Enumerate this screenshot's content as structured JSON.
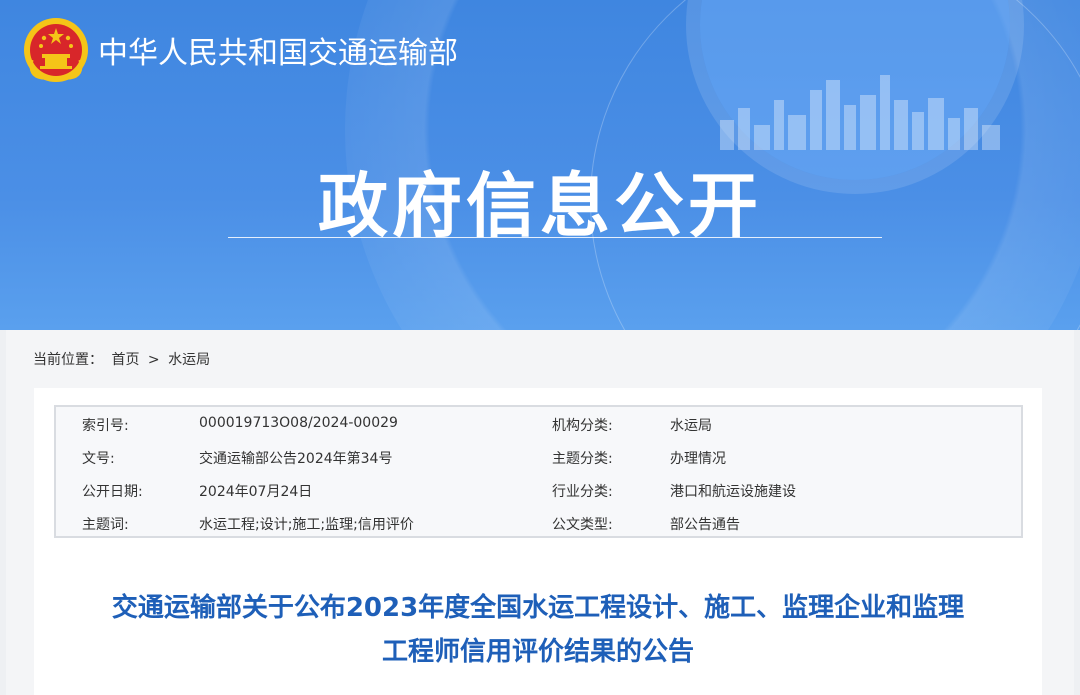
{
  "header": {
    "site_name": "中华人民共和国交通运输部",
    "section_title": "政府信息公开"
  },
  "breadcrumb": {
    "prefix": "当前位置：",
    "home": "首页",
    "separator": ">",
    "current": "水运局"
  },
  "meta": {
    "rows": [
      {
        "label1": "索引号:",
        "value1": "000019713O08/2024-00029",
        "label2": "机构分类:",
        "value2": "水运局"
      },
      {
        "label1": "文号:",
        "value1": "交通运输部公告2024年第34号",
        "label2": "主题分类:",
        "value2": "办理情况"
      },
      {
        "label1": "公开日期:",
        "value1": "2024年07月24日",
        "label2": "行业分类:",
        "value2": "港口和航运设施建设"
      },
      {
        "label1": "主题词:",
        "value1": "水运工程;设计;施工;监理;信用评价",
        "label2": "公文类型:",
        "value2": "部公告通告"
      }
    ]
  },
  "document": {
    "title_line1": "交通运输部关于公布2023年度全国水运工程设计、施工、监理企业和监理",
    "title_line2": "工程师信用评价结果的公告"
  },
  "colors": {
    "banner": "#4b8fe6",
    "title_blue": "#1e5fb8"
  }
}
